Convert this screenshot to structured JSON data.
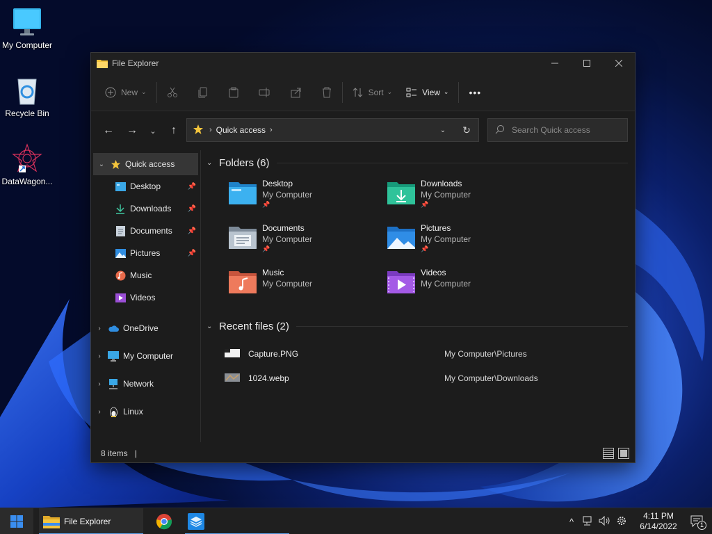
{
  "desktop": {
    "icons": [
      {
        "label": "My Computer"
      },
      {
        "label": "Recycle Bin"
      },
      {
        "label": "DataWagon..."
      }
    ]
  },
  "window": {
    "title": "File Explorer",
    "toolbar": {
      "new_label": "New",
      "sort_label": "Sort",
      "view_label": "View",
      "more_label": "•••"
    },
    "address": {
      "crumb": "Quick access",
      "search_placeholder": "Search Quick access"
    },
    "sidebar": {
      "quick_access": "Quick access",
      "pinned": [
        {
          "label": "Desktop"
        },
        {
          "label": "Downloads"
        },
        {
          "label": "Documents"
        },
        {
          "label": "Pictures"
        }
      ],
      "unpinned": [
        {
          "label": "Music"
        },
        {
          "label": "Videos"
        }
      ],
      "roots": [
        {
          "label": "OneDrive"
        },
        {
          "label": "My Computer"
        },
        {
          "label": "Network"
        },
        {
          "label": "Linux"
        }
      ]
    },
    "folders_header": "Folders (6)",
    "folders": [
      {
        "name": "Desktop",
        "location": "My Computer",
        "pinned": true
      },
      {
        "name": "Downloads",
        "location": "My Computer",
        "pinned": true
      },
      {
        "name": "Documents",
        "location": "My Computer",
        "pinned": true
      },
      {
        "name": "Pictures",
        "location": "My Computer",
        "pinned": true
      },
      {
        "name": "Music",
        "location": "My Computer",
        "pinned": false
      },
      {
        "name": "Videos",
        "location": "My Computer",
        "pinned": false
      }
    ],
    "recent_header": "Recent files (2)",
    "recent_files": [
      {
        "name": "Capture.PNG",
        "location": "My Computer\\Pictures"
      },
      {
        "name": "1024.webp",
        "location": "My Computer\\Downloads"
      }
    ],
    "status": {
      "items": "8 items",
      "cursor": "|"
    }
  },
  "taskbar": {
    "file_explorer_label": "File Explorer",
    "time": "4:11 PM",
    "date": "6/14/2022",
    "notification_count": "1"
  },
  "colors": {
    "accent": "#5aa0e8",
    "folder_yellow": "#f3c43c",
    "window_bg": "#1c1c1c"
  }
}
